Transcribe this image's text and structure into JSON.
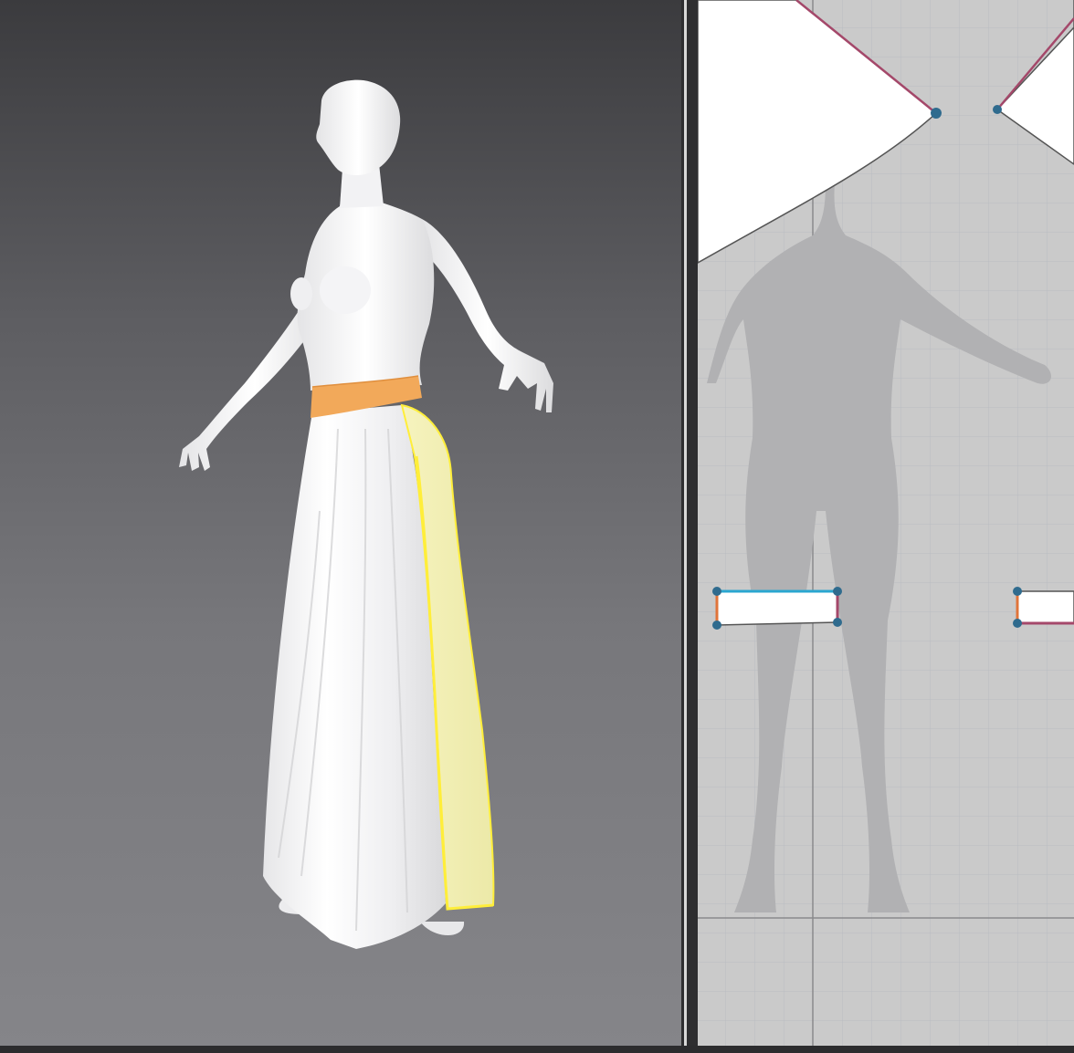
{
  "app": {
    "accent_selected": "#ffee3a",
    "waistband_color": "#f2a95a",
    "panel_bg_3d": "#5d5d61",
    "panel_bg_2d": "#cacaca"
  },
  "viewport_3d": {
    "avatar": "female-avatar",
    "garment": "long-skirt-with-waistband",
    "selected_piece": "right-skirt-panel"
  },
  "viewport_2d": {
    "grid": true,
    "avatar_silhouette": "female-avatar-silhouette",
    "pieces": [
      "skirt-panel-left",
      "skirt-panel-right",
      "waistband-left",
      "waistband-right"
    ]
  }
}
